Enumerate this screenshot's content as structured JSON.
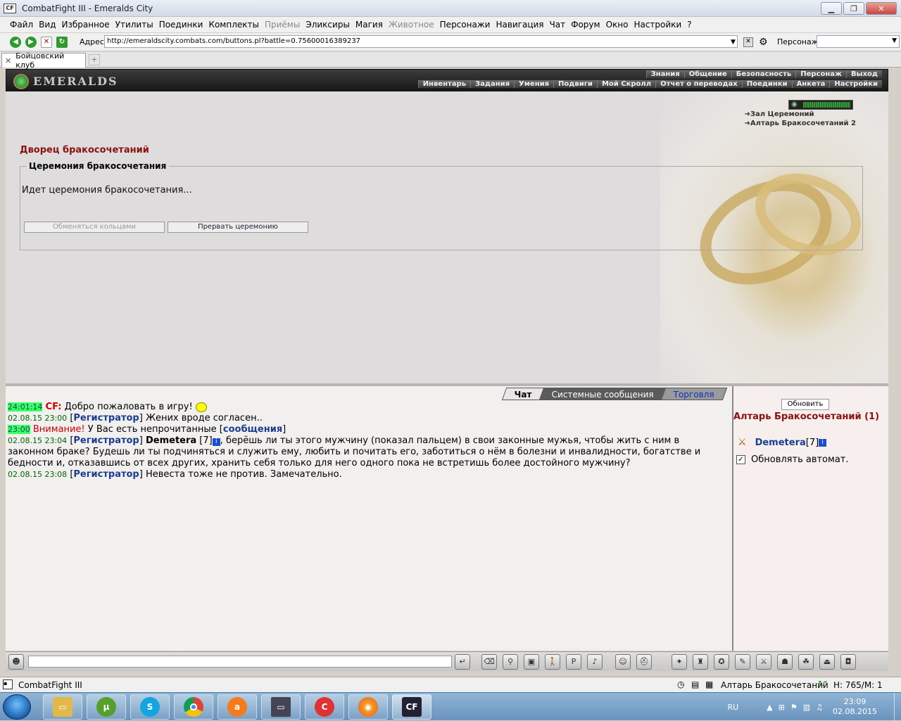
{
  "window": {
    "title": "CombatFight III - Emeralds City",
    "logo": "CF"
  },
  "menu": {
    "items": [
      "Файл",
      "Вид",
      "Избранное",
      "Утилиты",
      "Поединки",
      "Комплекты",
      "Приёмы",
      "Эликсиры",
      "Магия",
      "Животное",
      "Персонажи",
      "Навигация",
      "Чат",
      "Форум",
      "Окно",
      "Настройки",
      "?"
    ],
    "disabled": [
      "Приёмы",
      "Животное"
    ]
  },
  "addressbar": {
    "label": "Адрес:",
    "url": "http://emeraldscity.combats.com/buttons.pl?battle=0.75600016389237",
    "persona_label": "Персонаж:",
    "persona_value": ""
  },
  "tabs": [
    {
      "label": "Бойцовский клуб"
    }
  ],
  "header": {
    "logo": "EMERALDS",
    "top_nav": [
      "Знания",
      "Общение",
      "Безопасность",
      "Персонаж",
      "Выход"
    ],
    "bottom_nav": [
      "Инвентарь",
      "Задания",
      "Умения",
      "Подвиги",
      "Мой Скролл",
      "Отчет о переводах",
      "Поединки",
      "Анкета",
      "Настройки"
    ]
  },
  "main": {
    "title": "Дворец бракосочетаний",
    "fieldset_legend": "Церемония бракосочетания",
    "status_text": "Идет церемония бракосочетания...",
    "exchange_rings_label": "Обменяться кольцами",
    "stop_ceremony_label": "Прервать церемонию",
    "links": [
      "Зал Церемоний",
      "Алтарь Бракосочетаний 2"
    ],
    "hp_fraction": 0.95
  },
  "chat": {
    "tabs": [
      "Чат",
      "Системные сообщения",
      "Торговля"
    ],
    "active_tab": "Чат",
    "lines": [
      {
        "time": "24:01:14",
        "highlight": true,
        "sender": "CF:",
        "text": "Добро пожаловать в игру!"
      },
      {
        "time": "02.08.15 23:00",
        "sender": "Регистратор",
        "text": "Жених вроде согласен.."
      },
      {
        "time": "23:00",
        "highlight": true,
        "warning": "Внимание!",
        "text": "У Вас есть непрочитанные",
        "link": "сообщения"
      },
      {
        "time": "02.08.15 23:04",
        "sender": "Регистратор",
        "target": "Demetera",
        "level": "[7]",
        "text": ", берёшь ли ты этого мужчину (показал пальцем) в свои законные мужья, чтобы жить с ним в законном браке? Будешь ли ты подчиняться и служить ему, любить и почитать его, заботиться о нём в болезни и инвалидности, богатстве и бедности и, отказавшись от всех других, хранить себя только для него одного пока не встретишь более достойного мужчину?"
      },
      {
        "time": "02.08.15 23:08",
        "sender": "Регистратор",
        "text": "Невеста тоже не против. Замечательно."
      }
    ]
  },
  "sidebar": {
    "refresh_label": "Обновить",
    "room_title": "Алтарь Бракосочетаний (1)",
    "user_name": "Demetera",
    "user_level": "[7]",
    "auto_refresh_label": "Обновлять автомат."
  },
  "statusbar": {
    "left": "CombatFight III",
    "location": "Алтарь Бракосочетаний",
    "hp_mp": "H: 765/M: 1"
  },
  "taskbar": {
    "lang": "RU",
    "time": "23:09",
    "date": "02.08.2015",
    "apps": [
      "explorer-icon",
      "utorrent-icon",
      "skype-icon",
      "chrome-icon",
      "avast-icon",
      "monitor-icon",
      "ccleaner-icon",
      "firefox-icon",
      "cf-icon"
    ],
    "cf_label": "CF"
  }
}
